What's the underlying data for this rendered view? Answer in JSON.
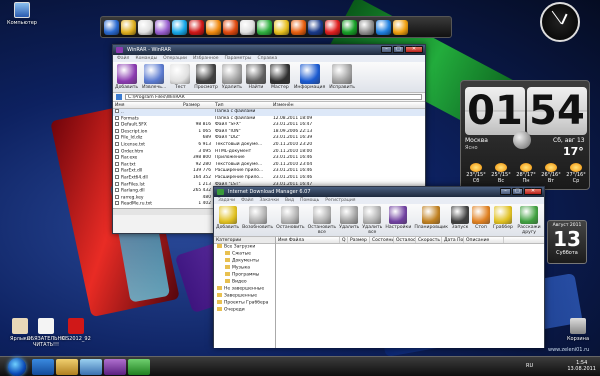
{
  "desktop": {
    "icons_top": [
      {
        "label": "Компьютер",
        "color": "#4a8ad0"
      }
    ],
    "icons_bottom": [
      {
        "label": "Ярлыки",
        "color": "#e8d8b8"
      },
      {
        "label": "ОБЯЗАТЕЛЬНО ЧИТАТЬ!!!",
        "color": "#f4f4f4"
      },
      {
        "label": "KIS2012_92",
        "color": "#d01818"
      }
    ],
    "recycle": {
      "label": "Корзина"
    }
  },
  "dock": {
    "items": [
      {
        "icon": "monitor-icon",
        "color": "#2a6ad0"
      },
      {
        "icon": "music-icon",
        "color": "#e0b020"
      },
      {
        "icon": "edit-icon",
        "color": "#e0e0e0"
      },
      {
        "icon": "wand-icon",
        "color": "#9a60d0"
      },
      {
        "icon": "skype-icon",
        "color": "#18a8e8"
      },
      {
        "icon": "opera-icon",
        "color": "#d01818"
      },
      {
        "icon": "orange-icon",
        "color": "#f08a10"
      },
      {
        "icon": "mail-icon",
        "color": "#e04a10"
      },
      {
        "icon": "home-icon",
        "color": "#e0e0e0"
      },
      {
        "icon": "cube-icon",
        "color": "#30b040"
      },
      {
        "icon": "chrome-icon",
        "color": "#e8c020"
      },
      {
        "icon": "firefox-icon",
        "color": "#e86010"
      },
      {
        "icon": "photoshop-icon",
        "color": "#1a3a8a"
      },
      {
        "icon": "warning-icon",
        "color": "#e02020"
      },
      {
        "icon": "torrent-icon",
        "color": "#18a028"
      },
      {
        "icon": "gear-icon",
        "color": "#909090"
      },
      {
        "icon": "globe-icon",
        "color": "#2080e0"
      },
      {
        "icon": "player-icon",
        "color": "#f0a010"
      }
    ]
  },
  "winrar": {
    "title": "WinRAR - WinRAR",
    "menu": [
      "Файл",
      "Команды",
      "Операции",
      "Избранное",
      "Параметры",
      "Справка"
    ],
    "toolbar": [
      {
        "label": "Добавить",
        "icon": "add-archive-icon",
        "color": "#8a3ab0"
      },
      {
        "label": "Извлечь...",
        "icon": "extract-icon",
        "color": "#5a7ad0"
      },
      {
        "label": "Тест",
        "icon": "test-icon",
        "color": "#e0e0e0"
      },
      {
        "label": "Просмотр",
        "icon": "view-icon",
        "color": "#404040"
      },
      {
        "label": "Удалить",
        "icon": "delete-icon",
        "color": "#a0a0a0"
      },
      {
        "label": "Найти",
        "icon": "find-icon",
        "color": "#606060"
      },
      {
        "label": "Мастер",
        "icon": "wizard-icon",
        "color": "#303030"
      },
      {
        "label": "Информация",
        "icon": "info-icon",
        "color": "#1a5ad0"
      },
      {
        "label": "Исправить",
        "icon": "repair-icon",
        "color": "#a0a0a0"
      }
    ],
    "path": "C:\\Program Files\\WinRAR",
    "columns": [
      "Имя",
      "Размер",
      "Тип",
      "Изменён"
    ],
    "rows": [
      {
        "name": "..",
        "size": "",
        "type": "Папка с файлами",
        "modified": ""
      },
      {
        "name": "Formats",
        "size": "",
        "type": "Папка с файлами",
        "modified": "12.08.2011 18:09"
      },
      {
        "name": "Default.SFX",
        "size": "98 816",
        "type": "Файл \"SFX\"",
        "modified": "23.01.2011 16:47"
      },
      {
        "name": "Descript.ion",
        "size": "1 065",
        "type": "Файл \"ION\"",
        "modified": "18.09.2006 22:13"
      },
      {
        "name": "File_Id.diz",
        "size": "689",
        "type": "Файл \"DIZ\"",
        "modified": "23.01.2011 16:39"
      },
      {
        "name": "License.txt",
        "size": "6 913",
        "type": "Текстовый докуме...",
        "modified": "20.11.2010 23:20"
      },
      {
        "name": "Order.htm",
        "size": "3 095",
        "type": "HTML-документ",
        "modified": "20.11.2010 18:00"
      },
      {
        "name": "Rar.exe",
        "size": "398 800",
        "type": "Приложение",
        "modified": "23.01.2011 16:46"
      },
      {
        "name": "Rar.txt",
        "size": "92 280",
        "type": "Текстовый докуме...",
        "modified": "20.11.2010 23:04"
      },
      {
        "name": "RarExt.dll",
        "size": "139 776",
        "type": "Расширение прило...",
        "modified": "23.01.2011 16:46"
      },
      {
        "name": "RarExt64.dll",
        "size": "164 352",
        "type": "Расширение прило...",
        "modified": "23.01.2011 16:46"
      },
      {
        "name": "RarFiles.lst",
        "size": "1 213",
        "type": "Файл \"LST\"",
        "modified": "23.01.2011 16:47"
      },
      {
        "name": "Rarlang.dll",
        "size": "265 432",
        "type": "Расширение прило...",
        "modified": "23.01.2011 16:47"
      },
      {
        "name": "rarreg.key",
        "size": "480",
        "type": "Файл \"KEY\"",
        "modified": "23.01.2011 16:47"
      },
      {
        "name": "ReadMe.ru.txt",
        "size": "1 402",
        "type": "Текстовый докуме...",
        "modified": "23.01.2011 16:47"
      }
    ]
  },
  "idm": {
    "title": "Internet Download Manager 6.07",
    "menu": [
      "Задачи",
      "Файл",
      "Закачки",
      "Вид",
      "Помощь",
      "Регистрация"
    ],
    "toolbar": [
      {
        "label": "Добавить",
        "icon": "add-url-icon",
        "color": "#e0c020"
      },
      {
        "label": "Возобновить",
        "icon": "resume-icon",
        "color": "#b0b0b0"
      },
      {
        "label": "Остановить",
        "icon": "stop-icon",
        "color": "#b0b0b0"
      },
      {
        "label": "Остановить все",
        "icon": "stop-all-icon",
        "color": "#b0b0b0"
      },
      {
        "label": "Удалить",
        "icon": "delete-icon",
        "color": "#a0a0a0"
      },
      {
        "label": "Удалить все",
        "icon": "delete-all-icon",
        "color": "#b0b0b0"
      },
      {
        "label": "Настройки",
        "icon": "settings-icon",
        "color": "#7040a0"
      },
      {
        "label": "Планировщик",
        "icon": "scheduler-icon",
        "color": "#c08020"
      },
      {
        "label": "Запуск",
        "icon": "start-queue-icon",
        "color": "#404040"
      },
      {
        "label": "Стоп",
        "icon": "stop-queue-icon",
        "color": "#e08020"
      },
      {
        "label": "Граббер",
        "icon": "grabber-icon",
        "color": "#e0c020"
      },
      {
        "label": "Расскажи другу",
        "icon": "tell-friend-icon",
        "color": "#40a040"
      }
    ],
    "categories_header": "Категории",
    "categories": [
      {
        "label": "Все Загрузки",
        "level": 0
      },
      {
        "label": "Сжатые",
        "level": 1
      },
      {
        "label": "Документы",
        "level": 1
      },
      {
        "label": "Музыка",
        "level": 1
      },
      {
        "label": "Программы",
        "level": 1
      },
      {
        "label": "Видео",
        "level": 1
      },
      {
        "label": "Не завершенные",
        "level": 0
      },
      {
        "label": "Завершенные",
        "level": 0
      },
      {
        "label": "Проекты Граббера",
        "level": 0
      },
      {
        "label": "Очереди",
        "level": 0
      }
    ],
    "columns": [
      "Имя Файла",
      "Q",
      "Размер",
      "Состояние",
      "Осталось",
      "Скорость",
      "Дата По...",
      "Описание"
    ]
  },
  "weather": {
    "hours": "01",
    "minutes": "54",
    "city": "Москва",
    "condition": "Ясно",
    "date": "Сб, авг 13",
    "temp": "17°",
    "forecast": [
      {
        "day": "Сб",
        "range": "23°/15°"
      },
      {
        "day": "Вс",
        "range": "25°/15°"
      },
      {
        "day": "Пн",
        "range": "28°/17°"
      },
      {
        "day": "Вт",
        "range": "26°/16°"
      },
      {
        "day": "Ср",
        "range": "27°/16°"
      }
    ]
  },
  "calendar": {
    "month": "Август 2011",
    "day": "13",
    "weekday": "Суббота"
  },
  "tray": {
    "lang": "RU",
    "time": "1:54",
    "date": "13.08.2011"
  },
  "watermark": "www.zeleni01.ru"
}
